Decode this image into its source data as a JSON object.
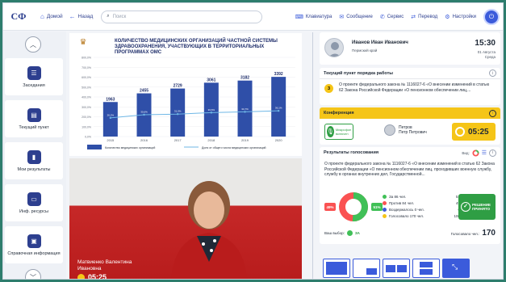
{
  "topbar": {
    "logo": "СФ",
    "home": "Домой",
    "back": "Назад",
    "search_placeholder": "Поиск",
    "tools": [
      {
        "icon": "keyboard-icon",
        "label": "Клавиатура",
        "glyph": "⌨"
      },
      {
        "icon": "message-icon",
        "label": "Сообщение",
        "glyph": "✉"
      },
      {
        "icon": "service-icon",
        "label": "Сервис",
        "glyph": "✆"
      },
      {
        "icon": "translate-icon",
        "label": "Перевод",
        "glyph": "⇄"
      },
      {
        "icon": "settings-icon",
        "label": "Настройки",
        "glyph": "⚙"
      }
    ]
  },
  "sidebar": {
    "items": [
      {
        "label": "Заседания",
        "icon": "meetings-icon"
      },
      {
        "label": "Текущий пункт",
        "icon": "current-item-icon"
      },
      {
        "label": "Мои результаты",
        "icon": "results-icon"
      },
      {
        "label": "Инф. ресурсы",
        "icon": "resources-icon"
      },
      {
        "label": "Справочная информация",
        "icon": "reference-icon"
      }
    ]
  },
  "slide": {
    "title": "КОЛИЧЕСТВО МЕДИЦИНСКИХ ОРГАНИЗАЦИЙ ЧАСТНОЙ СИСТЕМЫ ЗДРАВООХРАНЕНИЯ, УЧАСТВУЮЩИХ В ТЕРРИТОРИАЛЬНЫХ ПРОГРАММАХ ОМС"
  },
  "chart_data": {
    "type": "bar",
    "categories": [
      "2015",
      "2016",
      "2017",
      "2018",
      "2019",
      "2020"
    ],
    "series": [
      {
        "name": "Количество медицинских организаций",
        "type": "bar",
        "values": [
          1963,
          2455,
          2729,
          3061,
          3182,
          3392
        ]
      },
      {
        "name": "Доля от общего числа медицинских организаций",
        "type": "line",
        "values": [
          26.2,
          30.6,
          31.5,
          33.6,
          34.7,
          36.1
        ]
      }
    ],
    "y_ticks": [
      "0,0%",
      "100,0%",
      "200,0%",
      "300,0%",
      "400,0%",
      "500,0%",
      "600,0%",
      "700,0%",
      "800,0%"
    ],
    "ylim": [
      0,
      4500
    ],
    "legend": "bottom"
  },
  "video": {
    "name": "Матвиенко Валентина Ивановна",
    "timer": "05:25"
  },
  "user": {
    "name": "Иванов Иван Иванович",
    "role": "Пермский край",
    "time": "15:30",
    "date": "01 Августа",
    "weekday": "Среда"
  },
  "current_item": {
    "title": "Текущий пункт порядка работы",
    "number": "3",
    "text": "О проекте федерального закона № 1116027-6 «О внесении изменений в статью 62 Закона Российской Федерации «О пенсионном обеспечении лиц,..."
  },
  "conference": {
    "title": "Конференция",
    "mic_label": "Микрофон включен",
    "speaker_surname": "Петров",
    "speaker_name": "Петр Петрович",
    "timer": "05:25"
  },
  "voting": {
    "title": "Результаты голосования",
    "view_label": "Вид:",
    "text": "О проекте федерального закона № 1116027-6 «О внесении изменений в статью 62 Закона Российской Федерации «О пенсионном обеспечении лиц, проходивших военную службу, службу в органах внутренних дел, Государственной...",
    "pct_against": "49%",
    "pct_for": "51%",
    "results": [
      {
        "label": "За 86 чел.",
        "pct": "51%",
        "color": "#40c057"
      },
      {
        "label": "Против 84 чел.",
        "pct": "49%",
        "color": "#fa5252"
      },
      {
        "label": "Воздержалось 0 чел.",
        "pct": "0%",
        "color": "#3b5bdb"
      },
      {
        "label": "Голосовало 170 чел.",
        "pct": "100%",
        "color": "#f5c518"
      }
    ],
    "accepted": "РЕШЕНИЕ ПРИНЯТО",
    "my_choice_label": "Ваш выбор:",
    "my_choice": "ЗА",
    "voted_label": "Голосовало чел.:",
    "voted_count": "170"
  },
  "colors": {
    "accent": "#3b5bdb",
    "navy": "#2d3f8f",
    "yes": "#40c057",
    "no": "#fa5252",
    "yellow": "#f5c518"
  }
}
